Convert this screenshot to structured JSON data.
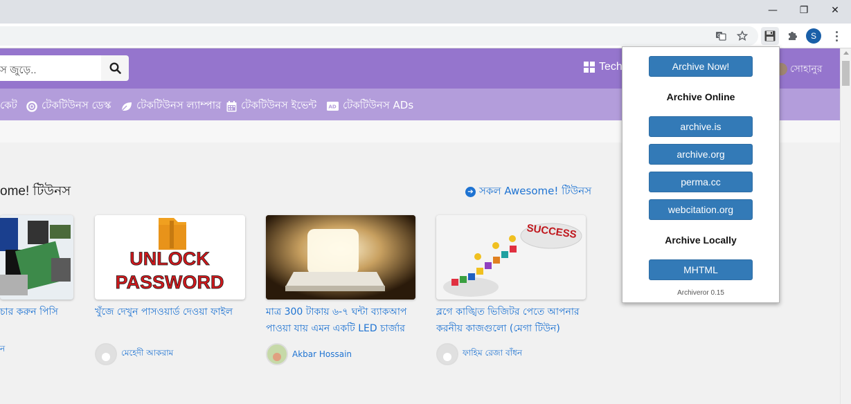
{
  "window_controls": {
    "minimize": "—",
    "restore": "❐",
    "close": "✕"
  },
  "toolbar": {
    "icons": [
      "translate-icon",
      "star-icon",
      "archiveror-icon",
      "extensions-icon"
    ],
    "profile_initial": "S"
  },
  "site": {
    "search_placeholder": "স জুড়ে..",
    "header_tech": "Tech",
    "header_user": "সোহানুর",
    "nav": [
      {
        "label": "কেট",
        "icon": ""
      },
      {
        "label": "টেকটিউনস ডেস্ক",
        "icon": "lifebuoy-icon"
      },
      {
        "label": "টেকটিউনস ল্যাম্পার",
        "icon": "leaf-icon"
      },
      {
        "label": "টেকটিউনস ইভেন্ট",
        "icon": "calendar-icon"
      },
      {
        "label": "টেকটিউনস ADs",
        "icon": "ad-icon"
      }
    ],
    "section_title": "ome! টিউনস",
    "section_link": "সকল Awesome! টিউনস"
  },
  "cards": [
    {
      "title": "চার করুন পিসি",
      "author": "ন"
    },
    {
      "title": "খুঁজে দেখুন পাসওয়ার্ড দেওয়া ফাইল",
      "author": "মেহেদী আকরাম",
      "image_text_1": "UNLOCK",
      "image_text_2": "PASSWORD"
    },
    {
      "title": "মাত্র 300 টাকায় ৬-৭ ঘন্টা ব্যাকআপ পাওয়া যায় এমন একটি LED চার্জার",
      "author": "Akbar Hossain"
    },
    {
      "title": "ব্লগে কাঙ্খিত ভিজিটর পেতে আপনার করনীয় কাজগুলো (মেগা টিউন)",
      "author": "ফাহিম রেজা বাঁধন",
      "image_text": "SUCCESS"
    }
  ],
  "popup": {
    "archive_now": "Archive Now!",
    "online_heading": "Archive Online",
    "online_buttons": [
      "archive.is",
      "archive.org",
      "perma.cc",
      "webcitation.org"
    ],
    "local_heading": "Archive Locally",
    "local_button": "MHTML",
    "version": "Archiveror 0.15"
  },
  "colors": {
    "header": "#9575cd",
    "nav": "#b39ddb",
    "link": "#1e73d2",
    "popup_button": "#337ab7"
  }
}
